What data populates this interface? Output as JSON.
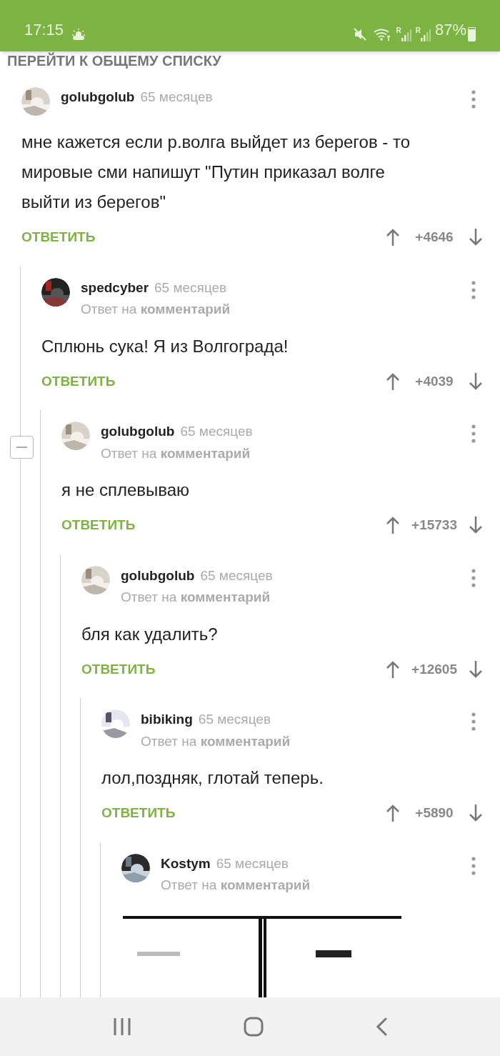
{
  "status_bar": {
    "time": "17:15",
    "signals": [
      {
        "label": "R"
      },
      {
        "label": "R"
      }
    ],
    "battery_text": "87%"
  },
  "header_link": "ПЕРЕЙТИ К ОБЩЕМУ СПИСКУ",
  "comments": [
    {
      "author": "golubgolub",
      "age": "65 месяцев",
      "text": "мне кажется если р.волга выйдет из берегов - то мировые сми напишут \"Путин приказал волге выйти из берегов\"",
      "reply_button": "ОТВЕТИТЬ",
      "score": "+4646",
      "collapsible": false,
      "children": [
        {
          "author": "spedcyber",
          "age": "65 месяцев",
          "reply_to": "Ответ на **комментарий**",
          "text": "Сплюнь сука! Я из Волгограда!",
          "reply_button": "ОТВЕТИТЬ",
          "score": "+4039",
          "collapsible": false,
          "children": [
            {
              "author": "golubgolub",
              "age": "65 месяцев",
              "reply_to": "Ответ на **комментарий**",
              "text": "я не сплевываю",
              "reply_button": "ОТВЕТИТЬ",
              "score": "+15733",
              "collapsible": true,
              "children": [
                {
                  "author": "golubgolub",
                  "age": "65 месяцев",
                  "reply_to": "Ответ на **комментарий**",
                  "text": "бля как удалить?",
                  "reply_button": "ОТВЕТИТЬ",
                  "score": "+12605",
                  "collapsible": false,
                  "children": [
                    {
                      "author": "bibiking",
                      "age": "65 месяцев",
                      "reply_to": "Ответ на **комментарий**",
                      "text": "лол,поздняк, глотай теперь.",
                      "reply_button": "ОТВЕТИТЬ",
                      "score": "+5890",
                      "collapsible": false,
                      "children": [
                        {
                          "author": "Kostym",
                          "age": "65 месяцев",
                          "reply_to": "Ответ на **комментарий**",
                          "collapsible": false
                        }
                      ]
                    }
                  ]
                }
              ]
            }
          ]
        }
      ]
    }
  ]
}
